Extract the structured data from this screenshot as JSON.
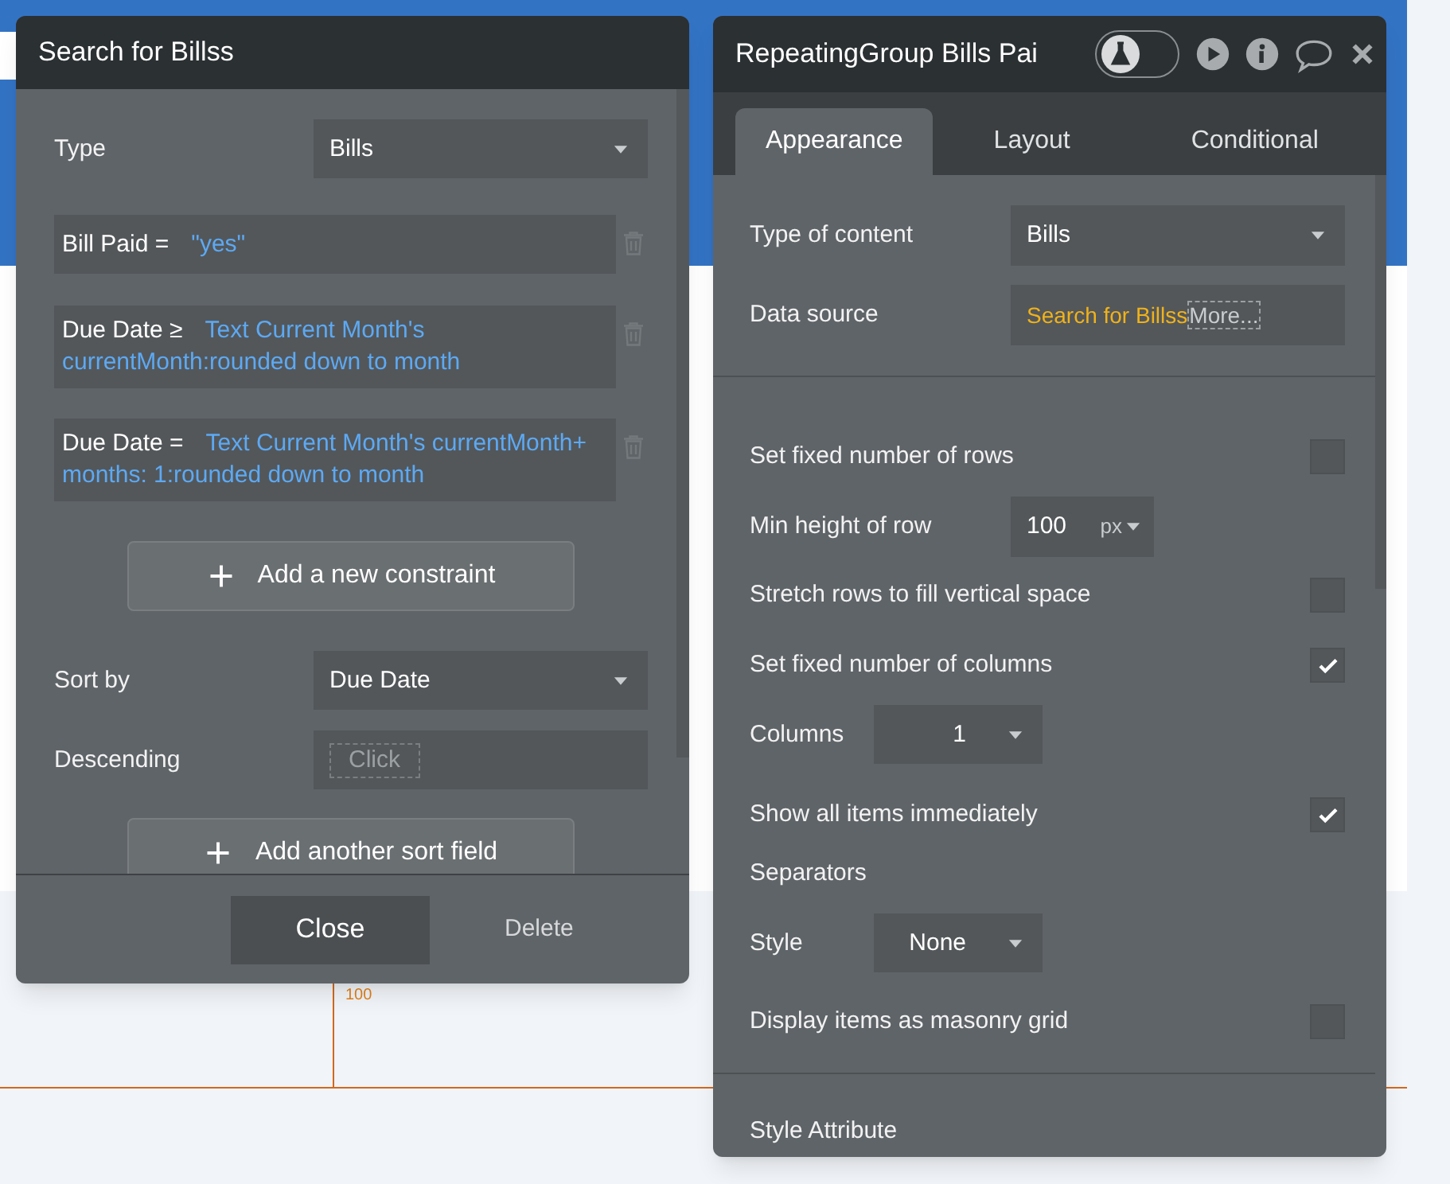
{
  "canvas": {
    "fragment_value": "100"
  },
  "search_panel": {
    "title": "Search for Billss",
    "type_label": "Type",
    "type_value": "Bills",
    "constraints": [
      {
        "field": "Bill Paid =",
        "value": "\"yes\""
      },
      {
        "field": "Due Date ≥",
        "value": "Text Current Month's currentMonth:rounded down to month"
      },
      {
        "field": "Due Date =",
        "value": "Text Current Month's currentMonth+ months: 1:rounded down to month"
      }
    ],
    "add_constraint": "Add a new constraint",
    "sort_by_label": "Sort by",
    "sort_by_value": "Due Date",
    "descending_label": "Descending",
    "descending_value": "Click",
    "add_sort": "Add another sort field",
    "close": "Close",
    "delete": "Delete"
  },
  "property_editor": {
    "title": "RepeatingGroup Bills Pai",
    "test_mode": {
      "on": false
    },
    "tabs": [
      {
        "label": "Appearance",
        "selected": true
      },
      {
        "label": "Layout",
        "selected": false
      },
      {
        "label": "Conditional",
        "selected": false
      }
    ],
    "type_of_content": {
      "label": "Type of content",
      "value": "Bills"
    },
    "data_source": {
      "label": "Data source",
      "value": "Search for Billss",
      "more": "More..."
    },
    "rows": [
      {
        "kind": "checkbox",
        "label": "Set fixed number of rows",
        "checked": false
      },
      {
        "kind": "number",
        "label": "Min height of row",
        "value": "100",
        "unit": "px"
      },
      {
        "kind": "checkbox",
        "label": "Stretch rows to fill vertical space",
        "checked": false
      },
      {
        "kind": "checkbox",
        "label": "Set fixed number of columns",
        "checked": true
      },
      {
        "kind": "select",
        "label": "Columns",
        "value": "1"
      },
      {
        "kind": "checkbox",
        "label": "Show all items immediately",
        "checked": true
      },
      {
        "kind": "heading",
        "label": "Separators"
      },
      {
        "kind": "select",
        "label": "Style",
        "value": "None"
      },
      {
        "kind": "checkbox",
        "label": "Display items as masonry grid",
        "checked": false
      }
    ],
    "section": "Style Attribute"
  }
}
